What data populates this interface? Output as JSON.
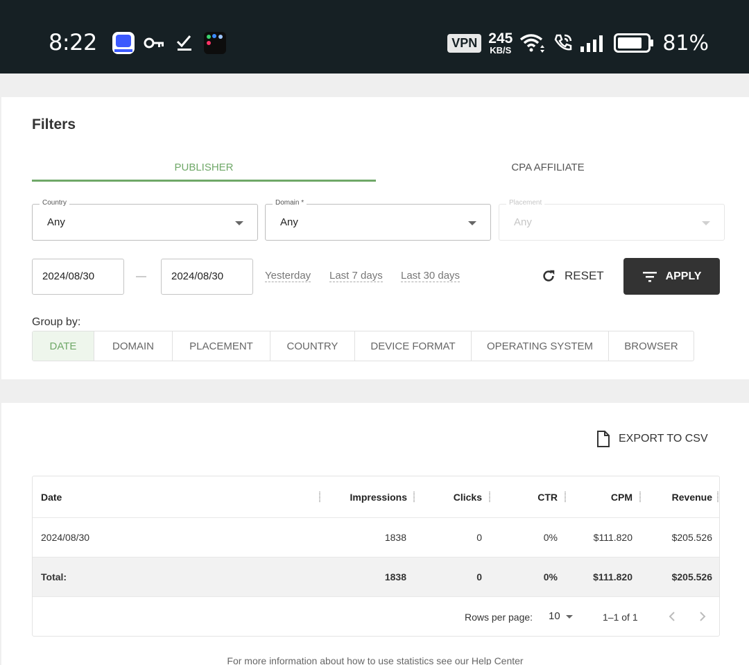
{
  "status_bar": {
    "time": "8:22",
    "vpn": "VPN",
    "speed_value": "245",
    "speed_unit": "KB/S",
    "battery": "81%",
    "icons": [
      "app-icon",
      "key-icon",
      "check-icon",
      "app-grid-icon",
      "wifi-icon",
      "wifi-call-icon",
      "signal-icon",
      "battery-icon"
    ]
  },
  "filters": {
    "title": "Filters",
    "tabs": [
      {
        "label": "PUBLISHER",
        "active": true
      },
      {
        "label": "CPA AFFILIATE",
        "active": false
      }
    ],
    "selects": [
      {
        "label": "Country",
        "value": "Any",
        "disabled": false
      },
      {
        "label": "Domain *",
        "value": "Any",
        "disabled": false
      },
      {
        "label": "Placement",
        "value": "Any",
        "disabled": true
      }
    ],
    "date_from": "2024/08/30",
    "date_to": "2024/08/30",
    "date_separator": "—",
    "quick_ranges": [
      "Yesterday",
      "Last 7 days",
      "Last 30 days"
    ],
    "reset_label": "RESET",
    "apply_label": "APPLY",
    "group_by_label": "Group by:",
    "group_by_options": [
      "DATE",
      "DOMAIN",
      "PLACEMENT",
      "COUNTRY",
      "DEVICE FORMAT",
      "OPERATING SYSTEM",
      "BROWSER"
    ],
    "group_by_selected": "DATE"
  },
  "report": {
    "export_label": "EXPORT TO CSV",
    "columns": [
      "Date",
      "Impressions",
      "Clicks",
      "CTR",
      "CPM",
      "Revenue"
    ],
    "rows": [
      [
        "2024/08/30",
        "1838",
        "0",
        "0%",
        "$111.820",
        "$205.526"
      ]
    ],
    "total": [
      "Total:",
      "1838",
      "0",
      "0%",
      "$111.820",
      "$205.526"
    ],
    "rows_per_page_label": "Rows per page:",
    "rows_per_page": "10",
    "range": "1–1 of 1",
    "footer_note": "For more information about how to use statistics see our Help Center"
  },
  "colors": {
    "accent": "#6fa868",
    "status_bar_bg": "#162024",
    "apply_bg": "#333333"
  }
}
